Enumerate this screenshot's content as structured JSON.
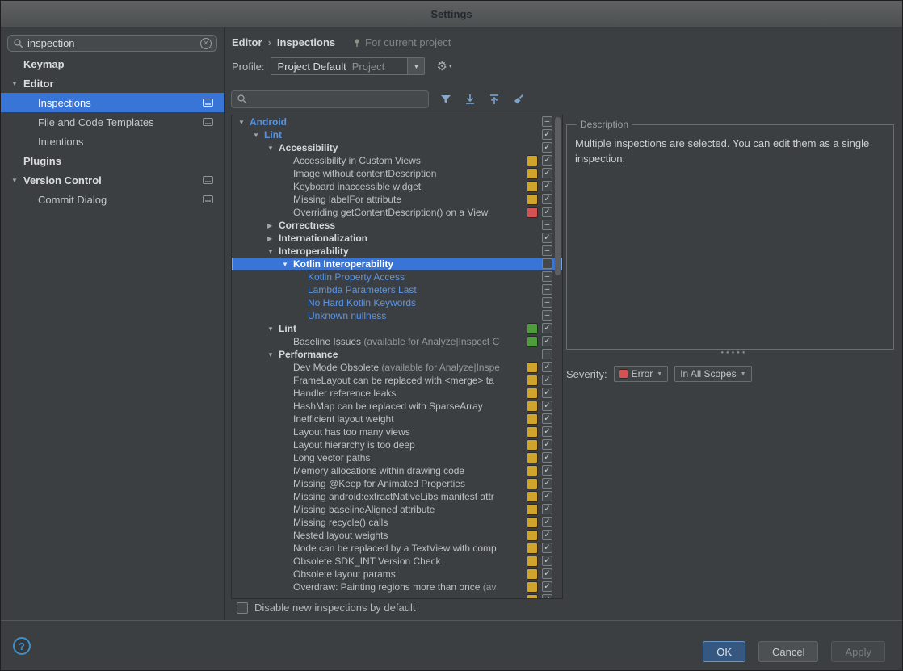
{
  "window": {
    "title": "Settings"
  },
  "colors": {
    "selection": "#3875d6",
    "badge_yellow": "#d0a42a",
    "badge_red": "#d45252",
    "badge_green": "#4f9c3c",
    "severity_error": "#d45252"
  },
  "sidebar": {
    "search": {
      "value": "inspection"
    },
    "items": [
      {
        "label": "Keymap",
        "level": 0,
        "kind": "item"
      },
      {
        "label": "Editor",
        "level": 0,
        "kind": "group",
        "arrow": "down"
      },
      {
        "label": "Inspections",
        "level": 1,
        "kind": "item",
        "selected": true,
        "icon": true
      },
      {
        "label": "File and Code Templates",
        "level": 1,
        "kind": "item",
        "icon": true
      },
      {
        "label": "Intentions",
        "level": 1,
        "kind": "item"
      },
      {
        "label": "Plugins",
        "level": 0,
        "kind": "item"
      },
      {
        "label": "Version Control",
        "level": 0,
        "kind": "group",
        "arrow": "down",
        "icon": true
      },
      {
        "label": "Commit Dialog",
        "level": 1,
        "kind": "item",
        "icon": true
      }
    ]
  },
  "header": {
    "breadcrumb": {
      "parent": "Editor",
      "separator": "›",
      "current": "Inspections"
    },
    "scope_note": "For current project"
  },
  "profile": {
    "label": "Profile:",
    "value": "Project Default",
    "hint": "Project"
  },
  "tree": {
    "rows": [
      {
        "label": "Android",
        "level": 0,
        "arrow": "down",
        "style": "blue-bold",
        "badge": null,
        "check": "dash"
      },
      {
        "label": "Lint",
        "level": 1,
        "arrow": "down",
        "style": "blue-bold",
        "badge": null,
        "check": "checked"
      },
      {
        "label": "Accessibility",
        "level": 2,
        "arrow": "down",
        "style": "bold",
        "badge": null,
        "check": "checked"
      },
      {
        "label": "Accessibility in Custom Views",
        "level": 3,
        "style": "plain",
        "badge": "yellow",
        "check": "checked"
      },
      {
        "label": "Image without contentDescription",
        "level": 3,
        "style": "plain",
        "badge": "yellow",
        "check": "checked"
      },
      {
        "label": "Keyboard inaccessible widget",
        "level": 3,
        "style": "plain",
        "badge": "yellow",
        "check": "checked"
      },
      {
        "label": "Missing labelFor attribute",
        "level": 3,
        "style": "plain",
        "badge": "yellow",
        "check": "checked"
      },
      {
        "label": "Overriding getContentDescription() on a View",
        "level": 3,
        "style": "plain",
        "badge": "red",
        "check": "checked"
      },
      {
        "label": "Correctness",
        "level": 2,
        "arrow": "right",
        "style": "bold",
        "badge": null,
        "check": "dash"
      },
      {
        "label": "Internationalization",
        "level": 2,
        "arrow": "right",
        "style": "bold",
        "badge": null,
        "check": "checked"
      },
      {
        "label": "Interoperability",
        "level": 2,
        "arrow": "down",
        "style": "bold",
        "badge": null,
        "check": "dash"
      },
      {
        "label": "Kotlin Interoperability",
        "level": 3,
        "arrow": "down",
        "style": "bold",
        "badge": null,
        "check": "empty",
        "selected": true
      },
      {
        "label": "Kotlin Property Access",
        "level": 4,
        "style": "blue",
        "badge": null,
        "check": "dash"
      },
      {
        "label": "Lambda Parameters Last",
        "level": 4,
        "style": "blue",
        "badge": null,
        "check": "dash"
      },
      {
        "label": "No Hard Kotlin Keywords",
        "level": 4,
        "style": "blue",
        "badge": null,
        "check": "dash"
      },
      {
        "label": "Unknown nullness",
        "level": 4,
        "style": "blue",
        "badge": null,
        "check": "dash"
      },
      {
        "label": "Lint",
        "level": 2,
        "arrow": "down",
        "style": "bold",
        "badge": "green",
        "check": "checked"
      },
      {
        "label": "Baseline Issues",
        "note": "(available for Analyze|Inspect C",
        "level": 3,
        "style": "plain",
        "badge": "green",
        "check": "checked"
      },
      {
        "label": "Performance",
        "level": 2,
        "arrow": "down",
        "style": "bold",
        "badge": null,
        "check": "dash"
      },
      {
        "label": "Dev Mode Obsolete",
        "note": "(available for Analyze|Inspe",
        "level": 3,
        "style": "plain",
        "badge": "yellow",
        "check": "checked"
      },
      {
        "label": "FrameLayout can be replaced with <merge> ta",
        "level": 3,
        "style": "plain",
        "badge": "yellow",
        "check": "checked"
      },
      {
        "label": "Handler reference leaks",
        "level": 3,
        "style": "plain",
        "badge": "yellow",
        "check": "checked"
      },
      {
        "label": "HashMap can be replaced with SparseArray",
        "level": 3,
        "style": "plain",
        "badge": "yellow",
        "check": "checked"
      },
      {
        "label": "Inefficient layout weight",
        "level": 3,
        "style": "plain",
        "badge": "yellow",
        "check": "checked"
      },
      {
        "label": "Layout has too many views",
        "level": 3,
        "style": "plain",
        "badge": "yellow",
        "check": "checked"
      },
      {
        "label": "Layout hierarchy is too deep",
        "level": 3,
        "style": "plain",
        "badge": "yellow",
        "check": "checked"
      },
      {
        "label": "Long vector paths",
        "level": 3,
        "style": "plain",
        "badge": "yellow",
        "check": "checked"
      },
      {
        "label": "Memory allocations within drawing code",
        "level": 3,
        "style": "plain",
        "badge": "yellow",
        "check": "checked"
      },
      {
        "label": "Missing @Keep for Animated Properties",
        "level": 3,
        "style": "plain",
        "badge": "yellow",
        "check": "checked"
      },
      {
        "label": "Missing android:extractNativeLibs manifest attr",
        "level": 3,
        "style": "plain",
        "badge": "yellow",
        "check": "checked"
      },
      {
        "label": "Missing baselineAligned attribute",
        "level": 3,
        "style": "plain",
        "badge": "yellow",
        "check": "checked"
      },
      {
        "label": "Missing recycle() calls",
        "level": 3,
        "style": "plain",
        "badge": "yellow",
        "check": "checked"
      },
      {
        "label": "Nested layout weights",
        "level": 3,
        "style": "plain",
        "badge": "yellow",
        "check": "checked"
      },
      {
        "label": "Node can be replaced by a TextView with comp",
        "level": 3,
        "style": "plain",
        "badge": "yellow",
        "check": "checked"
      },
      {
        "label": "Obsolete SDK_INT Version Check",
        "level": 3,
        "style": "plain",
        "badge": "yellow",
        "check": "checked"
      },
      {
        "label": "Obsolete layout params",
        "level": 3,
        "style": "plain",
        "badge": "yellow",
        "check": "checked"
      },
      {
        "label": "Overdraw: Painting regions more than once",
        "note": "(av",
        "level": 3,
        "style": "plain",
        "badge": "yellow",
        "check": "checked"
      },
      {
        "label": "",
        "level": 3,
        "style": "plain",
        "badge": "yellow",
        "check": "checked"
      }
    ]
  },
  "description": {
    "title": "Description",
    "body": "Multiple inspections are selected. You can edit them as a single inspection.",
    "severity_label": "Severity:",
    "severity_value": "Error",
    "scope_value": "In All Scopes"
  },
  "footer": {
    "disable_label": "Disable new inspections by default"
  },
  "buttons": {
    "ok": "OK",
    "cancel": "Cancel",
    "apply": "Apply"
  }
}
